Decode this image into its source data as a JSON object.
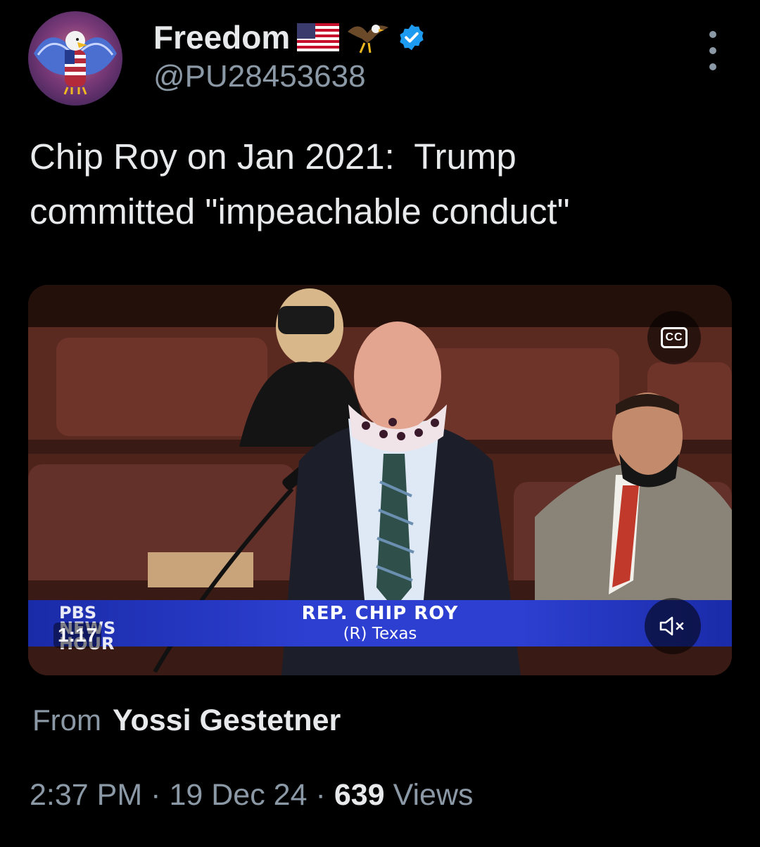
{
  "author": {
    "display_name": "Freedom",
    "handle": "@PU28453638",
    "avatar_icon": "eagle-avatar",
    "badges": [
      "us-flag-icon",
      "eagle-icon",
      "verified-badge-icon"
    ],
    "verified_color": "#1d9bf0"
  },
  "tweet": {
    "text": "Chip Roy on Jan 2021:  Trump\ncommitted \"impeachable conduct\""
  },
  "video": {
    "duration": "1:17",
    "cc_label": "CC",
    "lower_third": {
      "name": "REP. CHIP ROY",
      "subtitle": "(R) Texas"
    },
    "broadcaster_logo": [
      "PBS",
      "NEWS",
      "HOUR"
    ],
    "muted": true
  },
  "attribution": {
    "label": "From",
    "source": "Yossi Gestetner"
  },
  "meta": {
    "time": "2:37 PM",
    "sep1": "·",
    "date": "19 Dec 24",
    "sep2": "·",
    "views_count": "639",
    "views_label": "Views"
  },
  "colors": {
    "background": "#000000",
    "primary_text": "#e7e9ea",
    "secondary_text": "#8b98a5",
    "lower_third_blue": "#2c3fd0"
  }
}
